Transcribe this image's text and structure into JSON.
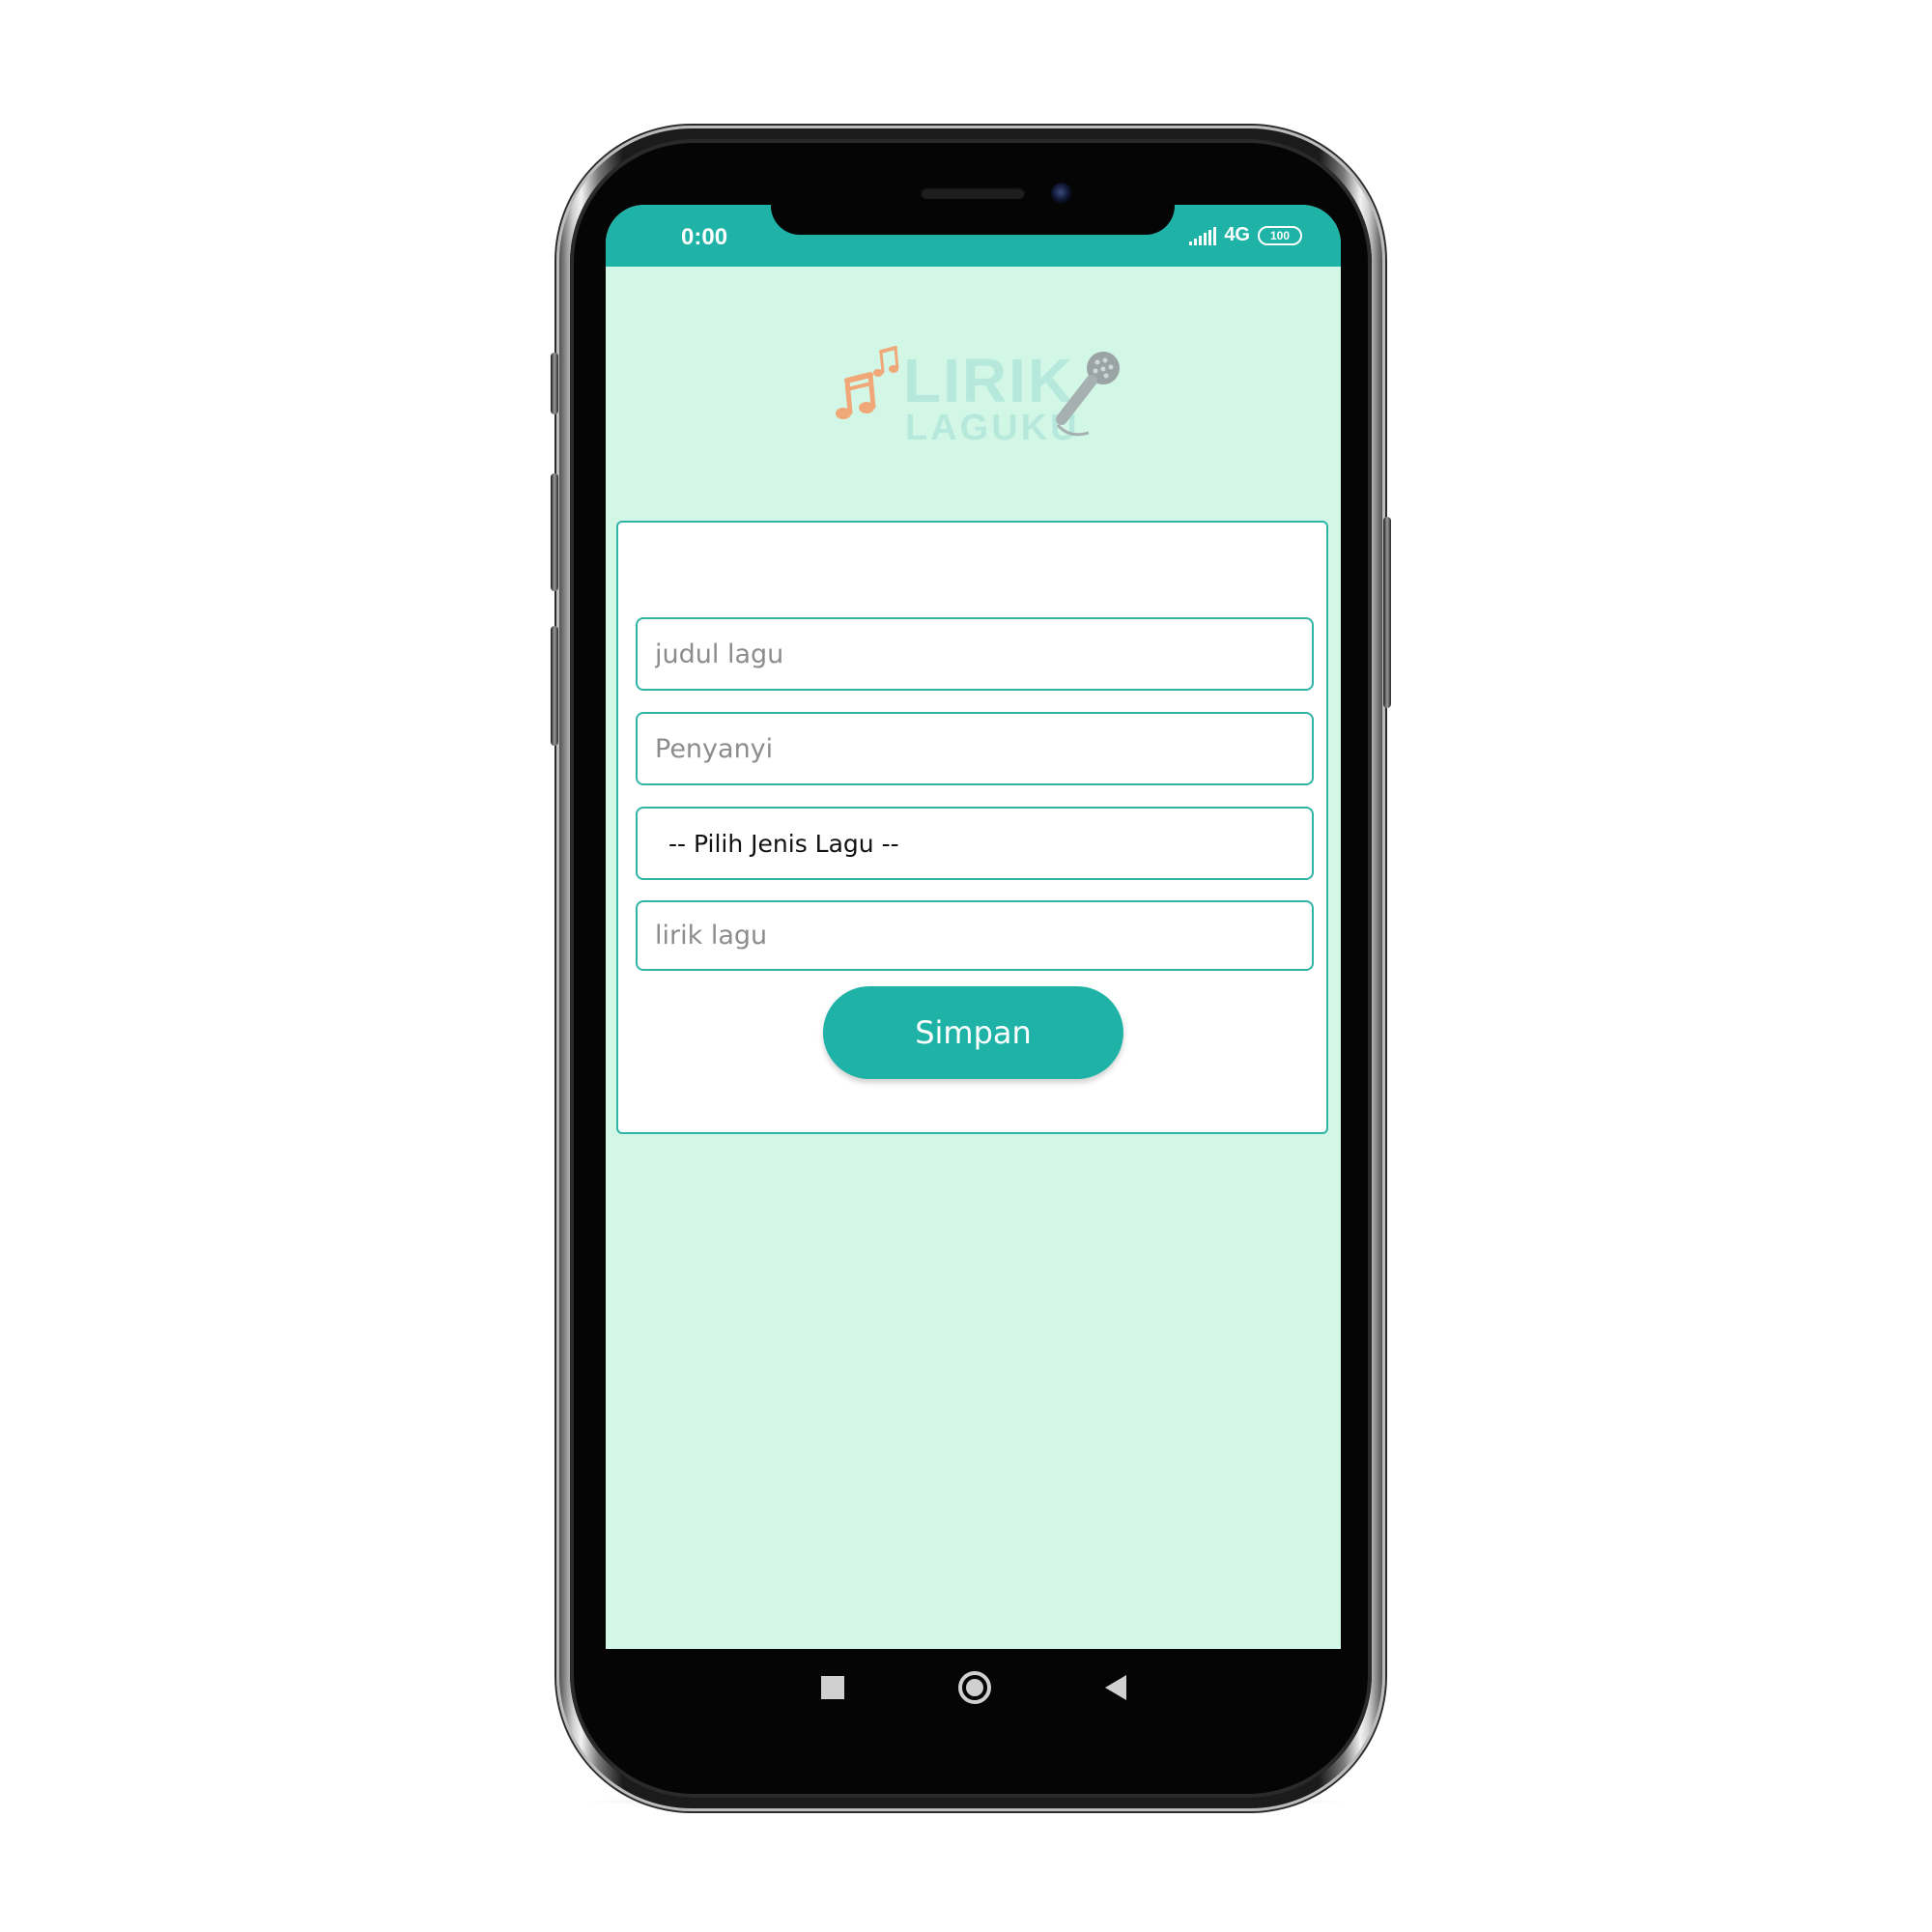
{
  "status_bar": {
    "time": "0:00",
    "network": "4G",
    "battery": "100"
  },
  "logo": {
    "line1": "LIRIK",
    "line2": "LAGUKU",
    "icons": [
      "music-notes-icon",
      "microphone-icon"
    ]
  },
  "form": {
    "title_placeholder": "judul lagu",
    "singer_placeholder": "Penyanyi",
    "genre_selected": "-- Pilih Jenis Lagu --",
    "lyrics_placeholder": "lirik lagu",
    "save_label": "Simpan"
  },
  "nav": {
    "icons": [
      "recent-apps-icon",
      "home-icon",
      "back-icon"
    ]
  },
  "colors": {
    "accent": "#1eb3a6",
    "screen_background": "#d3f7e6",
    "logo_text": "#b6e9dc",
    "logo_notes": "#f0a878"
  }
}
